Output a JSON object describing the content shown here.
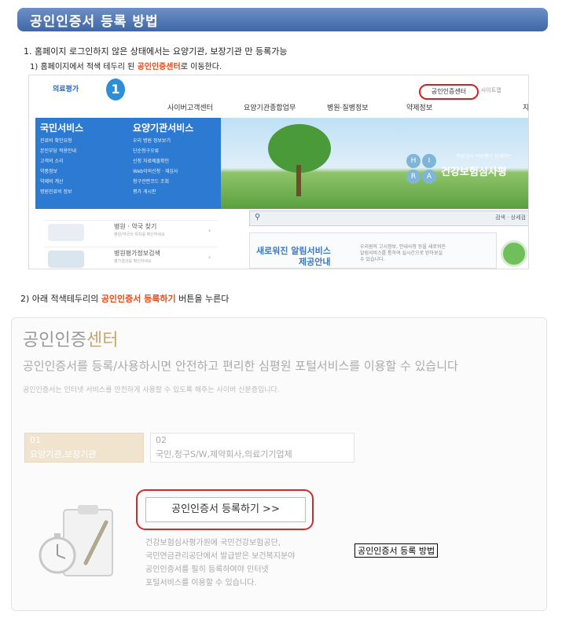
{
  "header": {
    "title": "공인인증서 등록 방법"
  },
  "step1": {
    "text": "1. 홈페이지 로그인하지 않은 상태에서는 요양기관, 보장기관 만 등록가능",
    "sub_prefix": "1) 홈페이지에서 적색 테두리 된 ",
    "sub_highlight": "공인인증센터",
    "sub_suffix": "로 이동한다."
  },
  "screenshot1": {
    "logo_text": "의료평가",
    "logo_icon": "1",
    "cert_center_link": "공인인증센터",
    "sitemap": "사이트맵",
    "nav": [
      "사이버고객센터",
      "요양기관종합업무",
      "병원·질병정보",
      "약제정보",
      "지속"
    ],
    "left_menu": {
      "citizen_head": "국민서비스",
      "provider_head": "요양기관서비스",
      "citizen_items": [
        "진료비 확인요청",
        "본인부담 적용안내",
        "고객의 소리",
        "약품정보",
        "약제비 계산",
        "병원진료비 정보"
      ],
      "provider_items": [
        "우리 병원 정보보기",
        "단순청구오류",
        "신청 자료제출확인",
        "Web이의신청 · 재심사",
        "청구관련코드 조회",
        "평가 게시판"
      ]
    },
    "hero_small": "바른심사 바른평가 함께하는",
    "hero_title": "건강보험심사평",
    "seal_letters": [
      "H",
      "I",
      "R",
      "A"
    ],
    "search_buttons": "검색 · 상세검",
    "promos": [
      {
        "title": "병원 · 약국 찾기",
        "sub": "병원/약국의 위치를 확인하세요"
      },
      {
        "title": "병원평가정보검색",
        "sub": "평가결과를 확인하세요"
      }
    ],
    "notice_title": "새로워진 알림서비스",
    "notice_title2": "제공안내",
    "notice_desc": "우리원의 고시정보, 안내사항 등을 새로워진 알림서비스를 통하여 실시간으로 받아보실 수 있습니다."
  },
  "step2": {
    "prefix": "2) 아래 적색테두리의 ",
    "highlight": "공인인증서 등록하기",
    "suffix": " 버튼을 누른다"
  },
  "screenshot2": {
    "title_a": "공인인증",
    "title_b": "센터",
    "lead": "공인인증서를 등록/사용하시면 안전하고 편리한 심평원 포털서비스를 이용할 수 있습니다",
    "desc": "공인인증서는 인터넷 서비스를 안전하게 사용할 수 있도록 해주는 사이버 신분증입니다.",
    "tabs": [
      {
        "num": "01",
        "label": "요양기관,보장기관"
      },
      {
        "num": "02",
        "label": "국민,청구S/W,제약회사,의료기기업체"
      }
    ],
    "register_button": "공인인증서 등록하기 >>",
    "para": [
      "건강보험심사평가원에 국민건강보험공단,",
      "국민연금관리공단에서 발급받은 보건복지분야",
      "공인인증서를 필히 등록하여야 인터넷",
      "포털서비스를 이용할 수 있습니다."
    ]
  },
  "caption": "공인인증서 등록 방법"
}
